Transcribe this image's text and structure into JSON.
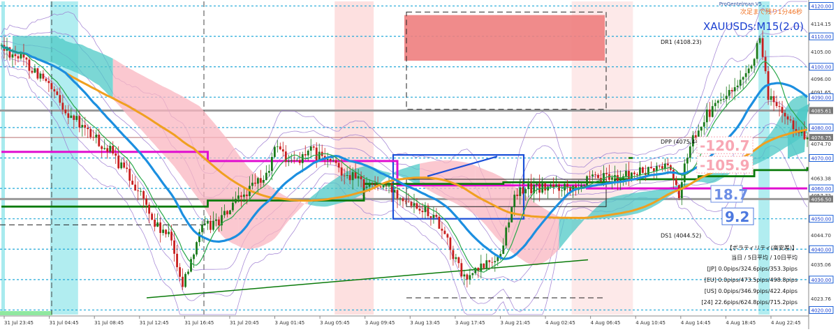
{
  "chart_data": {
    "type": "candlestick",
    "symbol_title": "XAUUSDs:M15(2.0)",
    "indicator_brand": "ProGentelman V5",
    "countdown_text": "次足まで残り1分46秒",
    "ylim": [
      4018.5,
      4121.5
    ],
    "y_ticks": [
      {
        "value": 4120.0,
        "label": "4120.00",
        "style": "box"
      },
      {
        "value": 4114.15,
        "label": "4114.15",
        "style": "plain"
      },
      {
        "value": 4110.0,
        "label": "4110.00",
        "style": "box"
      },
      {
        "value": 4105.0,
        "label": "4105.00",
        "style": "plain"
      },
      {
        "value": 4100.0,
        "label": "4100.00",
        "style": "box"
      },
      {
        "value": 4096.0,
        "label": "4096.00",
        "style": "plain"
      },
      {
        "value": 4091.65,
        "label": "4091.65",
        "style": "plain"
      },
      {
        "value": 4090.0,
        "label": "4090.00",
        "style": "box"
      },
      {
        "value": 4086.02,
        "label": "4086.02",
        "style": "plain"
      },
      {
        "value": 4085.61,
        "label": "4085.61",
        "style": "gray"
      },
      {
        "value": 4080.0,
        "label": "4080.00",
        "style": "box"
      },
      {
        "value": 4076.75,
        "label": "4076.75",
        "style": "gray"
      },
      {
        "value": 4074.7,
        "label": "4074.70",
        "style": "plain"
      },
      {
        "value": 4070.0,
        "label": "4070.00",
        "style": "box"
      },
      {
        "value": 4063.38,
        "label": "4063.38",
        "style": "plain"
      },
      {
        "value": 4060.0,
        "label": "4060.00",
        "style": "box"
      },
      {
        "value": 4057.72,
        "label": "4057.72",
        "style": "plain"
      },
      {
        "value": 4056.5,
        "label": "4056.50",
        "style": "gray"
      },
      {
        "value": 4050.0,
        "label": "4050.00",
        "style": "box"
      },
      {
        "value": 4044.7,
        "label": "4044.70",
        "style": "plain"
      },
      {
        "value": 4040.0,
        "label": "4040.00",
        "style": "box"
      },
      {
        "value": 4035.06,
        "label": "4035.06",
        "style": "plain"
      },
      {
        "value": 4030.0,
        "label": "4030.00",
        "style": "box"
      },
      {
        "value": 4023.76,
        "label": "4023.76",
        "style": "plain"
      },
      {
        "value": 4020.0,
        "label": "4020.00",
        "style": "box"
      }
    ],
    "x_labels": [
      "31 Jul 23:45",
      "31 Jul 04:45",
      "31 Jul 08:45",
      "31 Jul 12:45",
      "31 Jul 16:45",
      "31 Jul 20:45",
      "3 Aug 01:45",
      "3 Aug 05:45",
      "3 Aug 09:45",
      "3 Aug 13:45",
      "3 Aug 17:45",
      "3 Aug 21:45",
      "4 Aug 02:45",
      "4 Aug 06:45",
      "4 Aug 10:45",
      "4 Aug 14:45",
      "4 Aug 18:45",
      "4 Aug 22:45"
    ],
    "bar_count": 290,
    "price_path": [
      [
        0,
        4107
      ],
      [
        8,
        4103
      ],
      [
        15,
        4097
      ],
      [
        22,
        4088
      ],
      [
        30,
        4080
      ],
      [
        40,
        4072
      ],
      [
        50,
        4060
      ],
      [
        56,
        4048
      ],
      [
        62,
        4043
      ],
      [
        66,
        4028
      ],
      [
        72,
        4046
      ],
      [
        80,
        4050
      ],
      [
        88,
        4058
      ],
      [
        96,
        4064
      ],
      [
        100,
        4075
      ],
      [
        104,
        4068
      ],
      [
        112,
        4072
      ],
      [
        120,
        4068
      ],
      [
        130,
        4062
      ],
      [
        140,
        4060
      ],
      [
        150,
        4055
      ],
      [
        155,
        4052
      ],
      [
        160,
        4046
      ],
      [
        163,
        4038
      ],
      [
        167,
        4030
      ],
      [
        172,
        4033
      ],
      [
        176,
        4036
      ],
      [
        180,
        4038
      ],
      [
        184,
        4055
      ],
      [
        188,
        4060
      ],
      [
        195,
        4060
      ],
      [
        205,
        4061
      ],
      [
        215,
        4063
      ],
      [
        225,
        4064
      ],
      [
        235,
        4066
      ],
      [
        240,
        4068
      ],
      [
        244,
        4058
      ],
      [
        248,
        4075
      ],
      [
        252,
        4082
      ],
      [
        256,
        4086
      ],
      [
        260,
        4090
      ],
      [
        264,
        4092
      ],
      [
        268,
        4096
      ],
      [
        271,
        4104
      ],
      [
        273,
        4108
      ],
      [
        276,
        4091
      ],
      [
        280,
        4085
      ],
      [
        284,
        4082
      ],
      [
        288,
        4078
      ],
      [
        290,
        4077
      ]
    ],
    "levels": [
      {
        "name": "DR1",
        "label": "DR1 (4108.23)",
        "value": 4108.23
      },
      {
        "name": "DPP",
        "label": "DPP (4075.44)",
        "value": 4075.44
      },
      {
        "name": "DS1",
        "label": "DS1 (4044.52)",
        "value": 4044.52
      }
    ],
    "current_price": 4076.75,
    "pip_labels": [
      {
        "text": "-120.7",
        "color": "#f8a7b4",
        "value": 4074.2
      },
      {
        "text": "-105.9",
        "color": "#f8a7b4",
        "value": 4067.8
      },
      {
        "text": "18.7",
        "color": "#6d8fe6",
        "value": 4058.2
      },
      {
        "text": "9.2",
        "color": "#4c78df",
        "value": 4050.8
      }
    ],
    "volatility": {
      "title": "【ボラティリティ(高安差)】",
      "header": "当日 / 5日平均 / 10日平均",
      "rows": [
        "[JP] 0.0pips/324.6pips/353.3pips",
        "[EU] 0.0pips/473.5pips/498.8pips",
        "[US] 0.0pips/346.9pips/422.4pips",
        "[24] 22.6pips/624.8pips/715.2pips"
      ]
    },
    "colors": {
      "background": "#ffffff",
      "bull": "#1a7a1a",
      "bear": "#c81e1e",
      "ma_blue": "#1c8fe0",
      "ma_orange": "#f0a020",
      "ma_green": "#2aa84a",
      "magenta": "#e00ed0",
      "dark_green": "#0a7a0a",
      "grid_cyan": "#20a8d8",
      "kumo_bull": "#4fc9c7",
      "kumo_bear": "#f9b5c0",
      "zone": "#ee7e7e",
      "box_blue": "#1a4fd8",
      "bollinger": "#9a78d0",
      "session": "#9ee8ec",
      "highlight": "#fcd8d8",
      "title": "#1a3fd0",
      "countdown": "#f07020"
    }
  }
}
